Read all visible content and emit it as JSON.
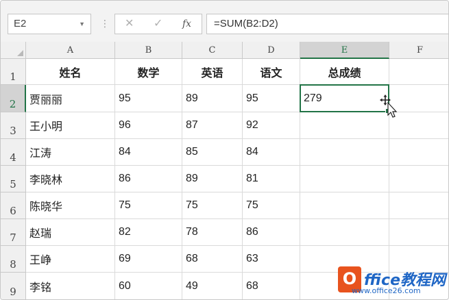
{
  "name_box": {
    "value": "E2"
  },
  "formula_bar": {
    "cancel_glyph": "✕",
    "enter_glyph": "✓",
    "fx_label": "fx",
    "formula": "=SUM(B2:D2)"
  },
  "column_headers": [
    "A",
    "B",
    "C",
    "D",
    "E",
    "F"
  ],
  "row_headers": [
    "1",
    "2",
    "3",
    "4",
    "5",
    "6",
    "7",
    "8",
    "9"
  ],
  "table": {
    "headers": [
      "姓名",
      "数学",
      "英语",
      "语文",
      "总成绩",
      ""
    ],
    "rows": [
      [
        "贾丽丽",
        "95",
        "89",
        "95",
        "279",
        ""
      ],
      [
        "王小明",
        "96",
        "87",
        "92",
        "",
        ""
      ],
      [
        "江涛",
        "84",
        "85",
        "84",
        "",
        ""
      ],
      [
        "李晓林",
        "86",
        "89",
        "81",
        "",
        ""
      ],
      [
        "陈晓华",
        "75",
        "75",
        "75",
        "",
        ""
      ],
      [
        "赵瑞",
        "82",
        "78",
        "86",
        "",
        ""
      ],
      [
        "王峥",
        "69",
        "68",
        "63",
        "",
        ""
      ],
      [
        "李铭",
        "60",
        "49",
        "68",
        "",
        ""
      ]
    ]
  },
  "selection": {
    "cell": "E2"
  },
  "watermark": {
    "badge": "O",
    "title": "ffice教程网",
    "url": "www.office26.com"
  },
  "colors": {
    "accent": "#217346",
    "header_bg": "#f0f0f0",
    "logo_orange": "#e8531e",
    "logo_blue": "#1f66c5"
  }
}
